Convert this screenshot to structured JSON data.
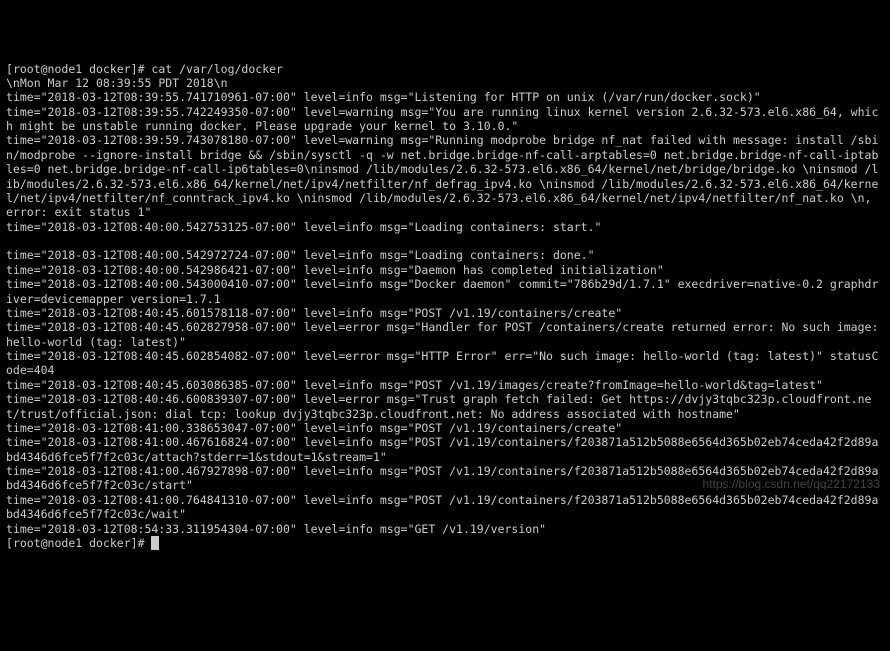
{
  "command_line_1": {
    "prompt_prefix": "[",
    "user_host": "root@node1 docker",
    "prompt_suffix": "]# ",
    "command": "cat /var/log/docker"
  },
  "lines": [
    "\\nMon Mar 12 08:39:55 PDT 2018\\n",
    "time=\"2018-03-12T08:39:55.741710961-07:00\" level=info msg=\"Listening for HTTP on unix (/var/run/docker.sock)\"",
    "time=\"2018-03-12T08:39:55.742249350-07:00\" level=warning msg=\"You are running linux kernel version 2.6.32-573.el6.x86_64, which might be unstable running docker. Please upgrade your kernel to 3.10.0.\"",
    "time=\"2018-03-12T08:39:59.743078180-07:00\" level=warning msg=\"Running modprobe bridge nf_nat failed with message: install /sbin/modprobe --ignore-install bridge && /sbin/sysctl -q -w net.bridge.bridge-nf-call-arptables=0 net.bridge.bridge-nf-call-iptables=0 net.bridge.bridge-nf-call-ip6tables=0\\ninsmod /lib/modules/2.6.32-573.el6.x86_64/kernel/net/bridge/bridge.ko \\ninsmod /lib/modules/2.6.32-573.el6.x86_64/kernel/net/ipv4/netfilter/nf_defrag_ipv4.ko \\ninsmod /lib/modules/2.6.32-573.el6.x86_64/kernel/net/ipv4/netfilter/nf_conntrack_ipv4.ko \\ninsmod /lib/modules/2.6.32-573.el6.x86_64/kernel/net/ipv4/netfilter/nf_nat.ko \\n, error: exit status 1\"",
    "time=\"2018-03-12T08:40:00.542753125-07:00\" level=info msg=\"Loading containers: start.\"",
    "",
    "time=\"2018-03-12T08:40:00.542972724-07:00\" level=info msg=\"Loading containers: done.\"",
    "time=\"2018-03-12T08:40:00.542986421-07:00\" level=info msg=\"Daemon has completed initialization\"",
    "time=\"2018-03-12T08:40:00.543000410-07:00\" level=info msg=\"Docker daemon\" commit=\"786b29d/1.7.1\" execdriver=native-0.2 graphdriver=devicemapper version=1.7.1",
    "time=\"2018-03-12T08:40:45.601578118-07:00\" level=info msg=\"POST /v1.19/containers/create\"",
    "time=\"2018-03-12T08:40:45.602827958-07:00\" level=error msg=\"Handler for POST /containers/create returned error: No such image: hello-world (tag: latest)\"",
    "time=\"2018-03-12T08:40:45.602854082-07:00\" level=error msg=\"HTTP Error\" err=\"No such image: hello-world (tag: latest)\" statusCode=404",
    "time=\"2018-03-12T08:40:45.603086385-07:00\" level=info msg=\"POST /v1.19/images/create?fromImage=hello-world&tag=latest\"",
    "time=\"2018-03-12T08:40:46.600839307-07:00\" level=error msg=\"Trust graph fetch failed: Get https://dvjy3tqbc323p.cloudfront.net/trust/official.json: dial tcp: lookup dvjy3tqbc323p.cloudfront.net: No address associated with hostname\"",
    "time=\"2018-03-12T08:41:00.338653047-07:00\" level=info msg=\"POST /v1.19/containers/create\"",
    "time=\"2018-03-12T08:41:00.467616824-07:00\" level=info msg=\"POST /v1.19/containers/f203871a512b5088e6564d365b02eb74ceda42f2d89abd4346d6fce5f7f2c03c/attach?stderr=1&stdout=1&stream=1\"",
    "time=\"2018-03-12T08:41:00.467927898-07:00\" level=info msg=\"POST /v1.19/containers/f203871a512b5088e6564d365b02eb74ceda42f2d89abd4346d6fce5f7f2c03c/start\"",
    "time=\"2018-03-12T08:41:00.764841310-07:00\" level=info msg=\"POST /v1.19/containers/f203871a512b5088e6564d365b02eb74ceda42f2d89abd4346d6fce5f7f2c03c/wait\"",
    "time=\"2018-03-12T08:54:33.311954304-07:00\" level=info msg=\"GET /v1.19/version\""
  ],
  "command_line_2": {
    "prompt_prefix": "[",
    "user_host": "root@node1 docker",
    "prompt_suffix": "]# "
  },
  "watermark": "https://blog.csdn.net/qq22172133"
}
